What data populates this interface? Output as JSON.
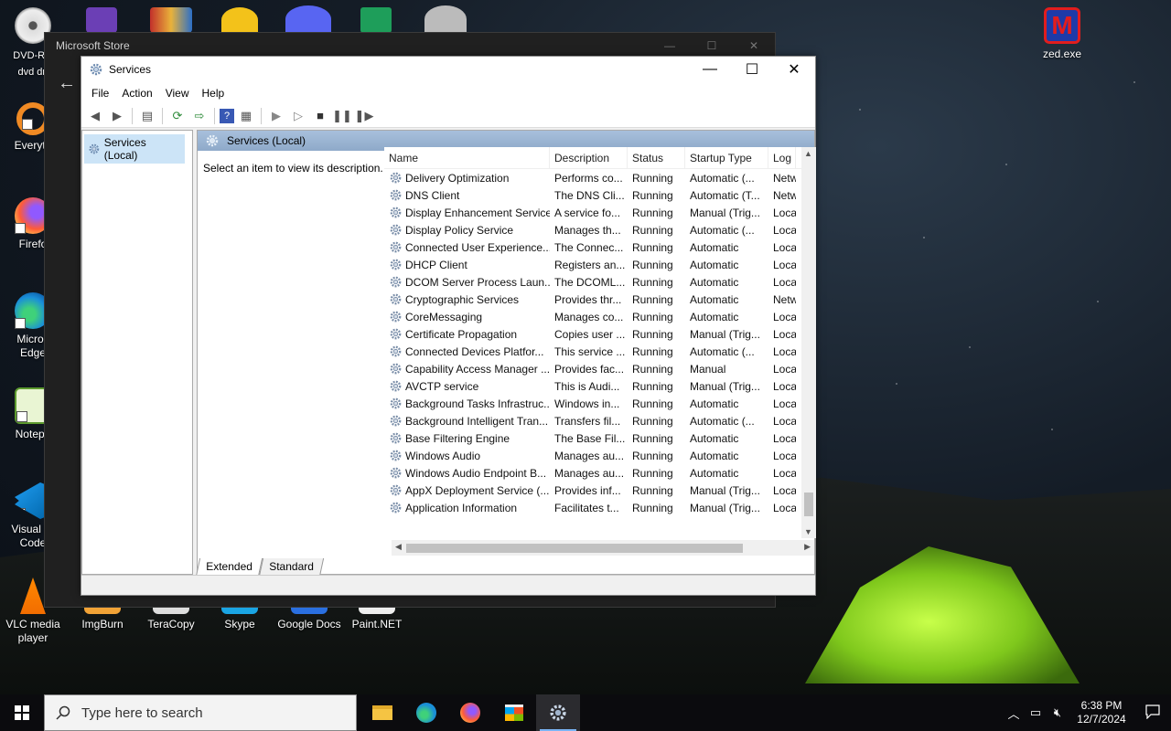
{
  "desktop": {
    "icons": [
      {
        "label": "DVD-RO\ndvd dri",
        "name": "dvd-drive"
      },
      {
        "label": "Everyth",
        "name": "everything"
      },
      {
        "label": "Firefo",
        "name": "firefox"
      },
      {
        "label": "Micros\nEdge",
        "name": "edge"
      },
      {
        "label": "Notepa",
        "name": "notepad"
      },
      {
        "label": "Visual St\nCode",
        "name": "vscode"
      },
      {
        "label": "VLC media\nplayer",
        "name": "vlc"
      },
      {
        "label": "ImgBurn",
        "name": "imgburn"
      },
      {
        "label": "TeraCopy",
        "name": "teracopy"
      },
      {
        "label": "Skype",
        "name": "skype"
      },
      {
        "label": "Google Docs",
        "name": "google-docs"
      },
      {
        "label": "Paint.NET",
        "name": "paintnet"
      },
      {
        "label": "zed.exe",
        "name": "zed"
      }
    ]
  },
  "store_window": {
    "title": "Microsoft Store"
  },
  "services_window": {
    "title": "Services",
    "menu": [
      "File",
      "Action",
      "View",
      "Help"
    ],
    "tree_item": "Services (Local)",
    "header": "Services (Local)",
    "description_prompt": "Select an item to view its description.",
    "columns": [
      "Name",
      "Description",
      "Status",
      "Startup Type",
      "Log"
    ],
    "rows": [
      [
        "Delivery Optimization",
        "Performs co...",
        "Running",
        "Automatic (...",
        "Netw"
      ],
      [
        "DNS Client",
        "The DNS Cli...",
        "Running",
        "Automatic (T...",
        "Netw"
      ],
      [
        "Display Enhancement Service",
        "A service fo...",
        "Running",
        "Manual (Trig...",
        "Loca"
      ],
      [
        "Display Policy Service",
        "Manages th...",
        "Running",
        "Automatic (...",
        "Loca"
      ],
      [
        "Connected User Experience...",
        "The Connec...",
        "Running",
        "Automatic",
        "Loca"
      ],
      [
        "DHCP Client",
        "Registers an...",
        "Running",
        "Automatic",
        "Loca"
      ],
      [
        "DCOM Server Process Laun...",
        "The DCOML...",
        "Running",
        "Automatic",
        "Loca"
      ],
      [
        "Cryptographic Services",
        "Provides thr...",
        "Running",
        "Automatic",
        "Netw"
      ],
      [
        "CoreMessaging",
        "Manages co...",
        "Running",
        "Automatic",
        "Loca"
      ],
      [
        "Certificate Propagation",
        "Copies user ...",
        "Running",
        "Manual (Trig...",
        "Loca"
      ],
      [
        "Connected Devices Platfor...",
        "This service ...",
        "Running",
        "Automatic (...",
        "Loca"
      ],
      [
        "Capability Access Manager ...",
        "Provides fac...",
        "Running",
        "Manual",
        "Loca"
      ],
      [
        "AVCTP service",
        "This is Audi...",
        "Running",
        "Manual (Trig...",
        "Loca"
      ],
      [
        "Background Tasks Infrastruc...",
        "Windows in...",
        "Running",
        "Automatic",
        "Loca"
      ],
      [
        "Background Intelligent Tran...",
        "Transfers fil...",
        "Running",
        "Automatic (...",
        "Loca"
      ],
      [
        "Base Filtering Engine",
        "The Base Fil...",
        "Running",
        "Automatic",
        "Loca"
      ],
      [
        "Windows Audio",
        "Manages au...",
        "Running",
        "Automatic",
        "Loca"
      ],
      [
        "Windows Audio Endpoint B...",
        "Manages au...",
        "Running",
        "Automatic",
        "Loca"
      ],
      [
        "AppX Deployment Service (...",
        "Provides inf...",
        "Running",
        "Manual (Trig...",
        "Loca"
      ],
      [
        "Application Information",
        "Facilitates t...",
        "Running",
        "Manual (Trig...",
        "Loca"
      ]
    ],
    "tabs": [
      "Extended",
      "Standard"
    ]
  },
  "taskbar": {
    "search_placeholder": "Type here to search",
    "time": "6:38 PM",
    "date": "12/7/2024"
  }
}
